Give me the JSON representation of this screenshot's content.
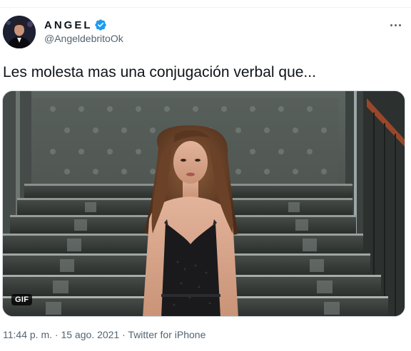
{
  "author": {
    "display_name": "ANGEL",
    "handle": "@AngeldebritoOk",
    "verified_icon": "verified-badge-icon",
    "avatar_icon": "avatar-portrait"
  },
  "menu": {
    "more_icon": "more-options-icon"
  },
  "tweet": {
    "text": "Les molesta mas una conjugación verbal que..."
  },
  "media": {
    "badge": "GIF",
    "image": "gif-woman-on-staircase"
  },
  "meta": {
    "time": "11:44 p. m.",
    "separator1": "·",
    "date": "15 ago. 2021",
    "separator2": "·",
    "source": "Twitter for iPhone"
  },
  "colors": {
    "verified": "#1d9bf0",
    "text": "#0f1419",
    "secondary": "#536471"
  }
}
